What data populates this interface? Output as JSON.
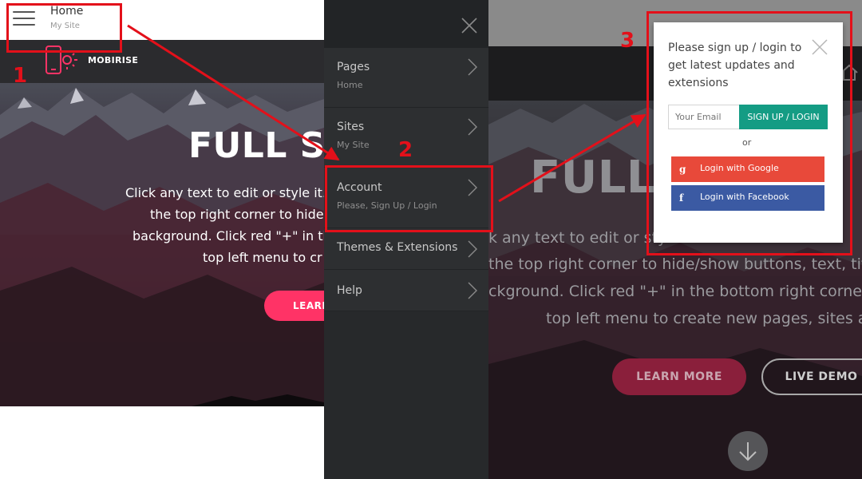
{
  "panel1": {
    "header": {
      "title": "Home",
      "subtitle": "My Site"
    },
    "brand": "MOBIRISE",
    "hero": {
      "title": "FULL S",
      "body_lines": [
        "Click any text to edit or style it.",
        "the top right corner to hide",
        "background. Click red \"+\" in th",
        "top left menu to cr"
      ],
      "button_label": "LEARN"
    }
  },
  "menu": {
    "items": [
      {
        "label": "Pages",
        "sub": "Home"
      },
      {
        "label": "Sites",
        "sub": "My Site"
      },
      {
        "label": "Account",
        "sub": "Please, Sign Up / Login"
      },
      {
        "label": "Themes & Extensions",
        "sub": ""
      },
      {
        "label": "Help",
        "sub": ""
      }
    ]
  },
  "panel3": {
    "hero": {
      "title": "FULL S      N",
      "body_lines": [
        "k any text to edit or styl                    nk",
        "the top right corner to hide/show buttons, text, title a",
        "ckground. Click red \"+\" in the bottom right corner to a",
        "top left menu to create new pages, sites and"
      ],
      "learn_more_label": "LEARN MORE",
      "live_demo_label": "LIVE DEMO"
    }
  },
  "modal": {
    "message": "Please sign up / login to get latest updates and extensions",
    "email_placeholder": "Your Email",
    "signup_label": "SIGN UP / LOGIN",
    "or_text": "or",
    "google_icon_text": "g",
    "google_label": "Login with Google",
    "facebook_icon_text": "f",
    "facebook_label": "Login with Facebook"
  },
  "annotations": {
    "step1": "1",
    "step2": "2",
    "step3": "3",
    "color": "#e3101a"
  },
  "colors": {
    "accent_pink": "#ff3366",
    "signup_green": "#149c84",
    "google_red": "#e8493a",
    "facebook_blue": "#3b5aa3"
  }
}
